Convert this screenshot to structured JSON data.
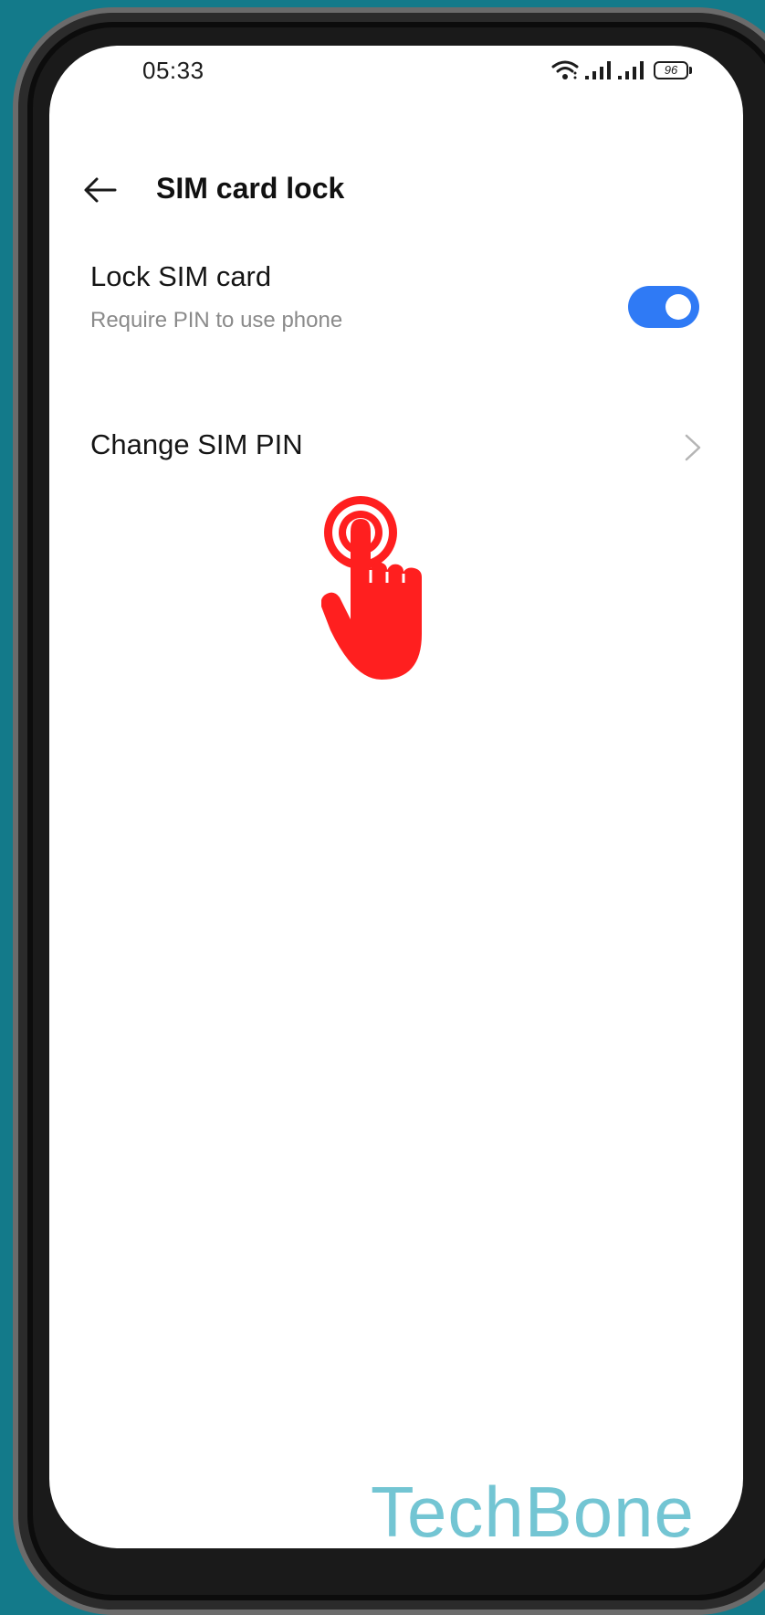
{
  "status_bar": {
    "time": "05:33",
    "battery_level": "96",
    "icons": [
      "wifi-icon",
      "signal-icon",
      "signal-icon",
      "battery-icon"
    ]
  },
  "header": {
    "title": "SIM card lock",
    "back_icon": "arrow-left-icon"
  },
  "settings": {
    "lock_sim": {
      "title": "Lock SIM card",
      "subtitle": "Require PIN to use phone",
      "toggle_on": true
    },
    "change_pin": {
      "title": "Change SIM PIN",
      "chevron_icon": "chevron-right-icon"
    }
  },
  "overlay": {
    "tap_indicator": "tap-hand-icon",
    "watermark": "TechBone"
  },
  "colors": {
    "background": "#137a8a",
    "toggle_accent": "#2f7af5",
    "tap_hand": "#ff1f1f",
    "watermark": "#73c5d3"
  }
}
